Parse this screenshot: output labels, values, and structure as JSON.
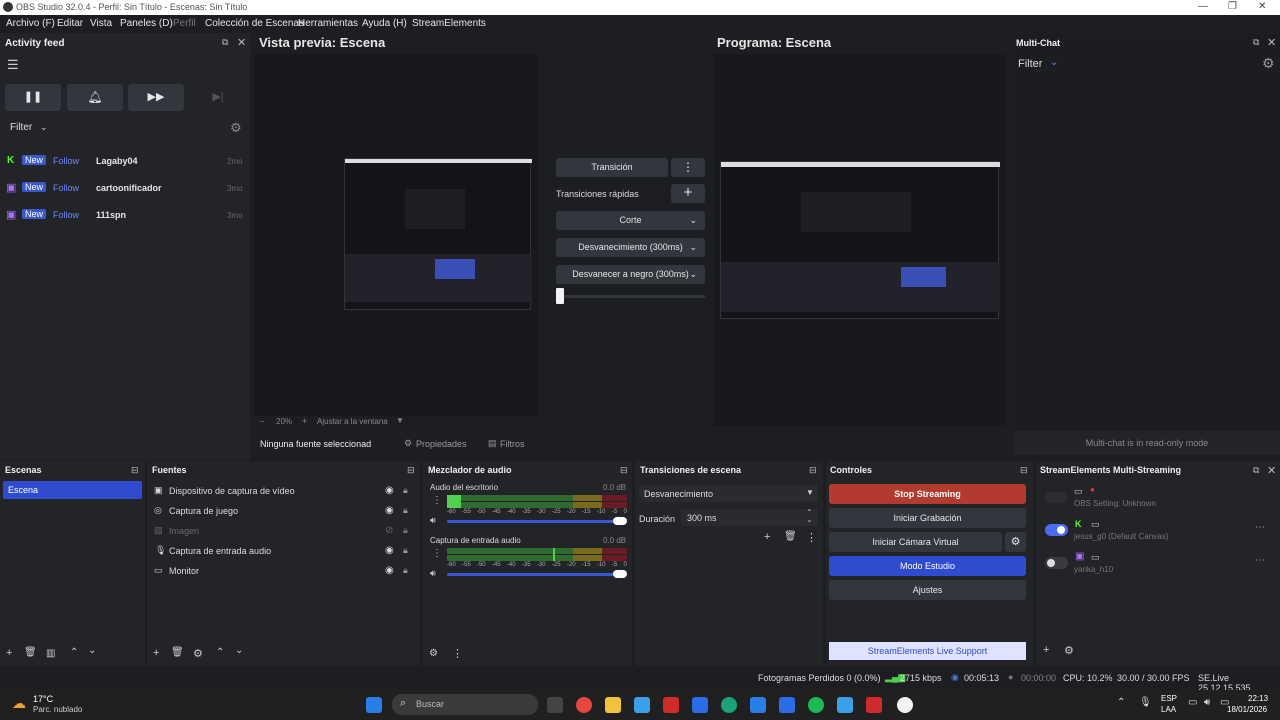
{
  "window": {
    "title": "OBS Studio 32.0.4 - Perfil: Sin Título - Escenas: Sin Título"
  },
  "menu": [
    "Archivo (F)",
    "Editar",
    "Vista",
    "Paneles (D)",
    "Perfil",
    "Colección de Escenas",
    "Herramientas",
    "Ayuda (H)",
    "StreamElements"
  ],
  "activity": {
    "title": "Activity feed",
    "filter": "Filter",
    "items": [
      {
        "badge": "New",
        "action": "Follow",
        "user": "Lagaby04",
        "time": "2mo"
      },
      {
        "badge": "New",
        "action": "Follow",
        "user": "cartoonificador",
        "time": "3mo"
      },
      {
        "badge": "New",
        "action": "Follow",
        "user": "111spn",
        "time": "3mo"
      }
    ]
  },
  "preview": {
    "title": "Vista previa: Escena",
    "zoom": "20%",
    "fit": "Ajustar a la ventana",
    "no_source": "Ninguna fuente seleccionad",
    "properties": "Propiedades",
    "filters": "Filtros"
  },
  "program": {
    "title": "Programa: Escena"
  },
  "transition": {
    "button": "Transición",
    "quick": "Transiciones rápidas",
    "items": [
      "Corte",
      "Desvanecimiento (300ms)",
      "Desvanecer a negro (300ms)"
    ]
  },
  "multichat": {
    "title": "Multi-Chat",
    "filter": "Filter",
    "readonly": "Multi-chat is in read-only mode"
  },
  "scenes": {
    "title": "Escenas",
    "items": [
      "Escena"
    ]
  },
  "sources": {
    "title": "Fuentes",
    "items": [
      "Dispositivo de captura de vídeo",
      "Captura de juego",
      "Imagen",
      "Captura de entrada audio",
      "Monitor"
    ]
  },
  "mixer": {
    "title": "Mezclador de audio",
    "channels": [
      {
        "name": "Audio del escritorio",
        "db": "0.0 dB"
      },
      {
        "name": "Captura de entrada audio",
        "db": "0.0 dB"
      }
    ],
    "scale": [
      "-60",
      "-55",
      "-50",
      "-45",
      "-40",
      "-35",
      "-30",
      "-25",
      "-20",
      "-15",
      "-10",
      "-5",
      "0"
    ]
  },
  "scene_transitions": {
    "title": "Transiciones de escena",
    "selected": "Desvanecimiento",
    "duration_label": "Duración",
    "duration_value": "300 ms"
  },
  "controls": {
    "title": "Controles",
    "stop": "Stop Streaming",
    "record": "Iniciar Grabación",
    "vcam": "Iniciar Cámara Virtual",
    "studio": "Modo Estudio",
    "settings": "Ajustes",
    "support": "StreamElements Live Support"
  },
  "multistream": {
    "title": "StreamElements Multi-Streaming",
    "items": [
      {
        "name": "OBS Setting: Unknown",
        "enabled": false
      },
      {
        "name": "jesus_g0 (Default Canvas)",
        "enabled": true
      },
      {
        "name": "yanka_h10",
        "enabled": false
      }
    ]
  },
  "status": {
    "dropped": "Fotogramas Perdidos 0 (0.0%)",
    "kbps": "2715 kbps",
    "stream_time": "00:05:13",
    "rec_time": "00:00:00",
    "cpu": "CPU: 10.2%",
    "fps": "30.00 / 30.00 FPS",
    "version": "SE.Live 25.12.15.535"
  },
  "taskbar": {
    "temp": "17°C",
    "weather": "Parc. nublado",
    "search": "Buscar",
    "lang": "ESP",
    "region": "LAA",
    "time": "22:13",
    "date": "18/01/2026"
  },
  "colors": {
    "accent": "#2f4bd0",
    "stop": "#b33a2e",
    "bg": "#1d1e22"
  }
}
